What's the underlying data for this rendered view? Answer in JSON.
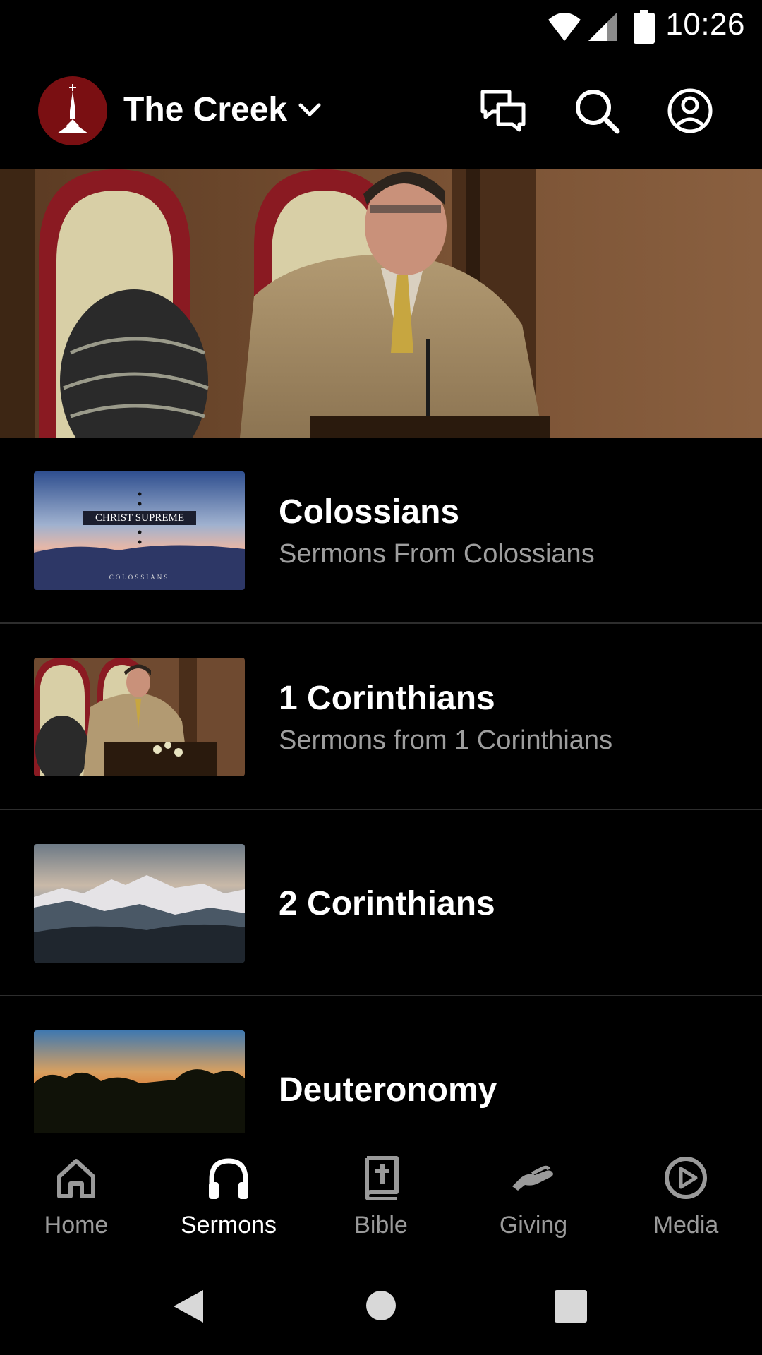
{
  "status_bar": {
    "time": "10:26",
    "icons": [
      "wifi-icon",
      "cell-signal-icon",
      "battery-icon"
    ]
  },
  "app_bar": {
    "church_name": "The Creek",
    "logo": "church-steeple-logo",
    "actions": [
      "chat-icon",
      "search-icon",
      "account-icon"
    ]
  },
  "hero": {
    "image": "pastor-preaching-photo"
  },
  "series": [
    {
      "title": "Colossians",
      "subtitle": "Sermons From Colossians",
      "thumb_title": "CHRIST SUPREME",
      "thumb_caption": "COLOSSIANS"
    },
    {
      "title": "1 Corinthians",
      "subtitle": "Sermons from 1 Corinthians"
    },
    {
      "title": "2 Corinthians",
      "subtitle": ""
    },
    {
      "title": "Deuteronomy",
      "subtitle": ""
    }
  ],
  "bottom_nav": [
    {
      "label": "Home",
      "icon": "home-icon",
      "active": false
    },
    {
      "label": "Sermons",
      "icon": "headphones-icon",
      "active": true
    },
    {
      "label": "Bible",
      "icon": "bible-icon",
      "active": false
    },
    {
      "label": "Giving",
      "icon": "giving-icon",
      "active": false
    },
    {
      "label": "Media",
      "icon": "play-circle-icon",
      "active": false
    }
  ],
  "colors": {
    "background": "#000000",
    "logo_red": "#7a0f12",
    "subtitle_gray": "#9e9e9e",
    "divider": "#2d2d2d",
    "nav_inactive": "#9a9a9a"
  }
}
